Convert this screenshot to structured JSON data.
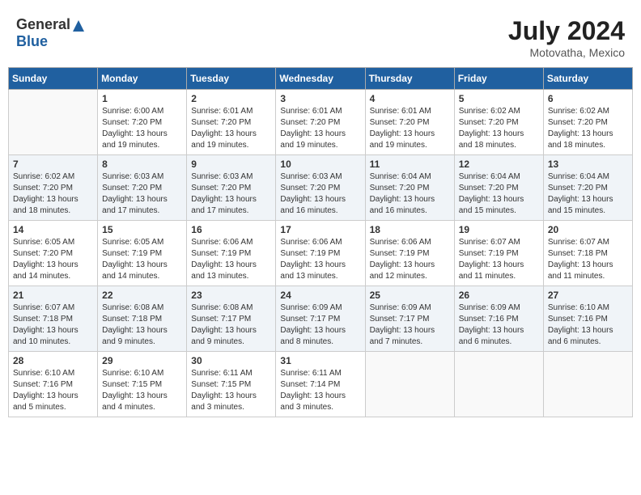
{
  "header": {
    "logo_general": "General",
    "logo_blue": "Blue",
    "month_year": "July 2024",
    "location": "Motovatha, Mexico"
  },
  "weekdays": [
    "Sunday",
    "Monday",
    "Tuesday",
    "Wednesday",
    "Thursday",
    "Friday",
    "Saturday"
  ],
  "weeks": [
    [
      {
        "day": "",
        "info": ""
      },
      {
        "day": "1",
        "info": "Sunrise: 6:00 AM\nSunset: 7:20 PM\nDaylight: 13 hours\nand 19 minutes."
      },
      {
        "day": "2",
        "info": "Sunrise: 6:01 AM\nSunset: 7:20 PM\nDaylight: 13 hours\nand 19 minutes."
      },
      {
        "day": "3",
        "info": "Sunrise: 6:01 AM\nSunset: 7:20 PM\nDaylight: 13 hours\nand 19 minutes."
      },
      {
        "day": "4",
        "info": "Sunrise: 6:01 AM\nSunset: 7:20 PM\nDaylight: 13 hours\nand 19 minutes."
      },
      {
        "day": "5",
        "info": "Sunrise: 6:02 AM\nSunset: 7:20 PM\nDaylight: 13 hours\nand 18 minutes."
      },
      {
        "day": "6",
        "info": "Sunrise: 6:02 AM\nSunset: 7:20 PM\nDaylight: 13 hours\nand 18 minutes."
      }
    ],
    [
      {
        "day": "7",
        "info": "Sunrise: 6:02 AM\nSunset: 7:20 PM\nDaylight: 13 hours\nand 18 minutes."
      },
      {
        "day": "8",
        "info": "Sunrise: 6:03 AM\nSunset: 7:20 PM\nDaylight: 13 hours\nand 17 minutes."
      },
      {
        "day": "9",
        "info": "Sunrise: 6:03 AM\nSunset: 7:20 PM\nDaylight: 13 hours\nand 17 minutes."
      },
      {
        "day": "10",
        "info": "Sunrise: 6:03 AM\nSunset: 7:20 PM\nDaylight: 13 hours\nand 16 minutes."
      },
      {
        "day": "11",
        "info": "Sunrise: 6:04 AM\nSunset: 7:20 PM\nDaylight: 13 hours\nand 16 minutes."
      },
      {
        "day": "12",
        "info": "Sunrise: 6:04 AM\nSunset: 7:20 PM\nDaylight: 13 hours\nand 15 minutes."
      },
      {
        "day": "13",
        "info": "Sunrise: 6:04 AM\nSunset: 7:20 PM\nDaylight: 13 hours\nand 15 minutes."
      }
    ],
    [
      {
        "day": "14",
        "info": "Sunrise: 6:05 AM\nSunset: 7:20 PM\nDaylight: 13 hours\nand 14 minutes."
      },
      {
        "day": "15",
        "info": "Sunrise: 6:05 AM\nSunset: 7:19 PM\nDaylight: 13 hours\nand 14 minutes."
      },
      {
        "day": "16",
        "info": "Sunrise: 6:06 AM\nSunset: 7:19 PM\nDaylight: 13 hours\nand 13 minutes."
      },
      {
        "day": "17",
        "info": "Sunrise: 6:06 AM\nSunset: 7:19 PM\nDaylight: 13 hours\nand 13 minutes."
      },
      {
        "day": "18",
        "info": "Sunrise: 6:06 AM\nSunset: 7:19 PM\nDaylight: 13 hours\nand 12 minutes."
      },
      {
        "day": "19",
        "info": "Sunrise: 6:07 AM\nSunset: 7:19 PM\nDaylight: 13 hours\nand 11 minutes."
      },
      {
        "day": "20",
        "info": "Sunrise: 6:07 AM\nSunset: 7:18 PM\nDaylight: 13 hours\nand 11 minutes."
      }
    ],
    [
      {
        "day": "21",
        "info": "Sunrise: 6:07 AM\nSunset: 7:18 PM\nDaylight: 13 hours\nand 10 minutes."
      },
      {
        "day": "22",
        "info": "Sunrise: 6:08 AM\nSunset: 7:18 PM\nDaylight: 13 hours\nand 9 minutes."
      },
      {
        "day": "23",
        "info": "Sunrise: 6:08 AM\nSunset: 7:17 PM\nDaylight: 13 hours\nand 9 minutes."
      },
      {
        "day": "24",
        "info": "Sunrise: 6:09 AM\nSunset: 7:17 PM\nDaylight: 13 hours\nand 8 minutes."
      },
      {
        "day": "25",
        "info": "Sunrise: 6:09 AM\nSunset: 7:17 PM\nDaylight: 13 hours\nand 7 minutes."
      },
      {
        "day": "26",
        "info": "Sunrise: 6:09 AM\nSunset: 7:16 PM\nDaylight: 13 hours\nand 6 minutes."
      },
      {
        "day": "27",
        "info": "Sunrise: 6:10 AM\nSunset: 7:16 PM\nDaylight: 13 hours\nand 6 minutes."
      }
    ],
    [
      {
        "day": "28",
        "info": "Sunrise: 6:10 AM\nSunset: 7:16 PM\nDaylight: 13 hours\nand 5 minutes."
      },
      {
        "day": "29",
        "info": "Sunrise: 6:10 AM\nSunset: 7:15 PM\nDaylight: 13 hours\nand 4 minutes."
      },
      {
        "day": "30",
        "info": "Sunrise: 6:11 AM\nSunset: 7:15 PM\nDaylight: 13 hours\nand 3 minutes."
      },
      {
        "day": "31",
        "info": "Sunrise: 6:11 AM\nSunset: 7:14 PM\nDaylight: 13 hours\nand 3 minutes."
      },
      {
        "day": "",
        "info": ""
      },
      {
        "day": "",
        "info": ""
      },
      {
        "day": "",
        "info": ""
      }
    ]
  ]
}
